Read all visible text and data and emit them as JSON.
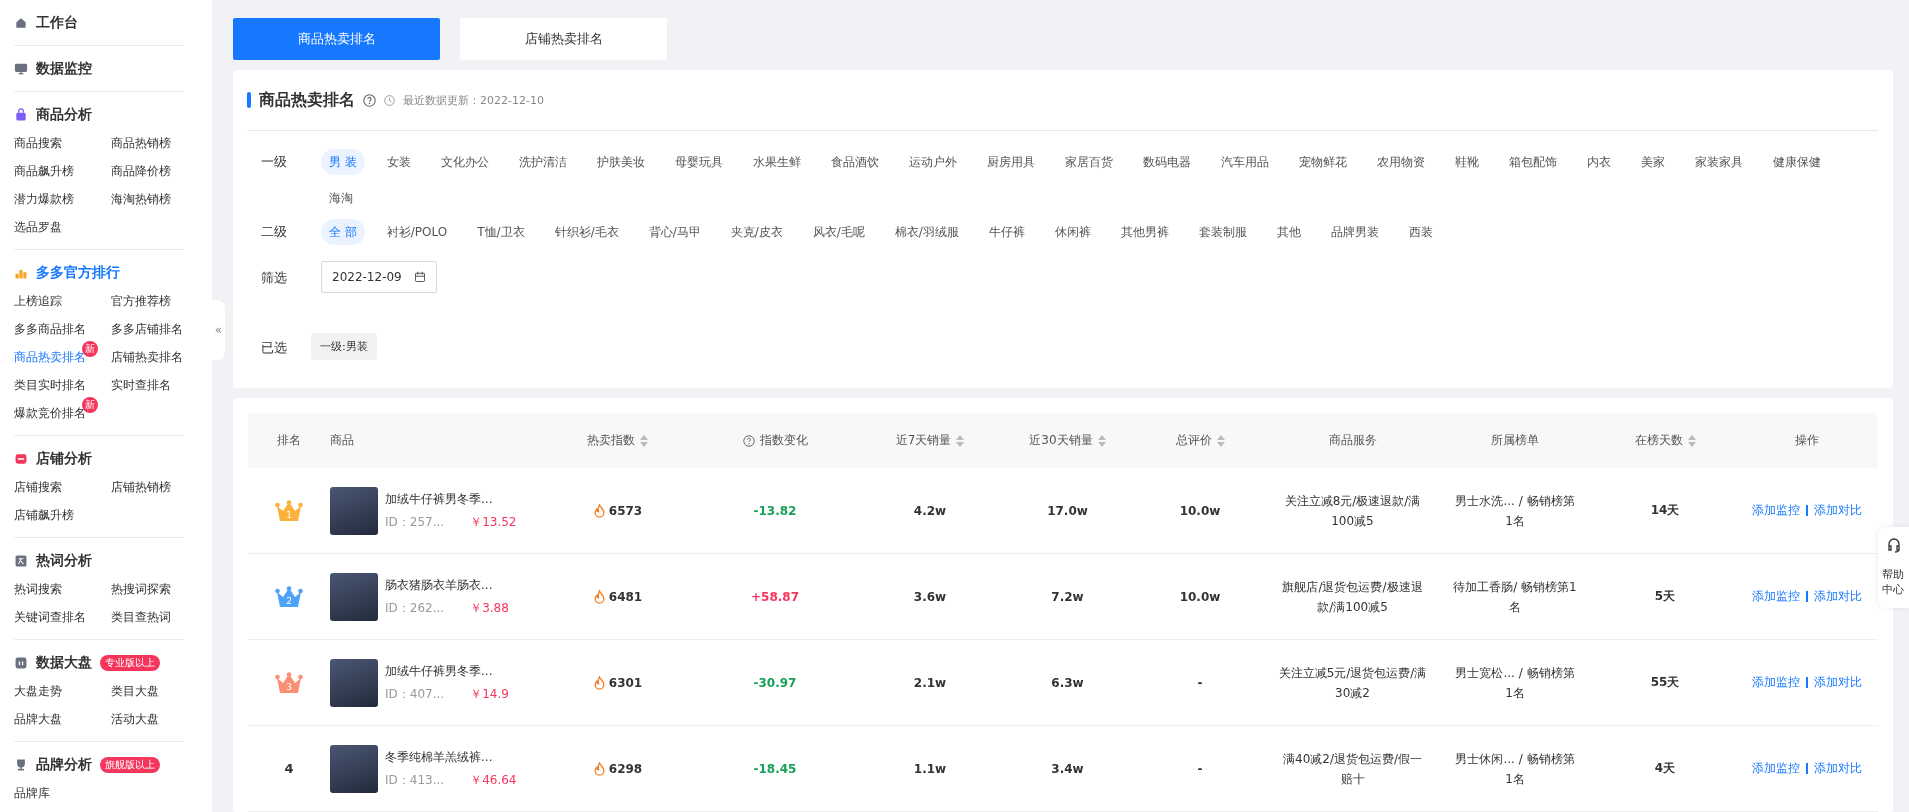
{
  "sidebar": {
    "sections": [
      {
        "title": "工作台",
        "active": false
      },
      {
        "title": "数据监控",
        "active": false
      },
      {
        "title": "商品分析",
        "active": false,
        "items": [
          {
            "label": "商品搜索",
            "selected": false
          },
          {
            "label": "商品热销榜",
            "selected": false
          },
          {
            "label": "商品飙升榜",
            "selected": false
          },
          {
            "label": "商品降价榜",
            "selected": false
          },
          {
            "label": "潜力爆款榜",
            "selected": false
          },
          {
            "label": "海淘热销榜",
            "selected": false
          },
          {
            "label": "选品罗盘",
            "selected": false
          }
        ]
      },
      {
        "title": "多多官方排行",
        "active": true,
        "items": [
          {
            "label": "上榜追踪",
            "selected": false
          },
          {
            "label": "官方推荐榜",
            "selected": false
          },
          {
            "label": "多多商品排名",
            "selected": false
          },
          {
            "label": "多多店铺排名",
            "selected": false
          },
          {
            "label": "商品热卖排名",
            "selected": true,
            "badge": "新"
          },
          {
            "label": "店铺热卖排名",
            "selected": false
          },
          {
            "label": "类目实时排名",
            "selected": false
          },
          {
            "label": "实时查排名",
            "selected": false
          },
          {
            "label": "爆款竞价排名",
            "selected": false,
            "badge": "新"
          }
        ]
      },
      {
        "title": "店铺分析",
        "active": false,
        "items": [
          {
            "label": "店铺搜索",
            "selected": false
          },
          {
            "label": "店铺热销榜",
            "selected": false
          },
          {
            "label": "店铺飙升榜",
            "selected": false
          }
        ]
      },
      {
        "title": "热词分析",
        "active": false,
        "items": [
          {
            "label": "热词搜索",
            "selected": false
          },
          {
            "label": "热搜词探索",
            "selected": false
          },
          {
            "label": "关键词查排名",
            "selected": false
          },
          {
            "label": "类目查热词",
            "selected": false
          }
        ]
      },
      {
        "title": "数据大盘",
        "active": false,
        "tag": "专业版以上",
        "items": [
          {
            "label": "大盘走势",
            "selected": false
          },
          {
            "label": "类目大盘",
            "selected": false
          },
          {
            "label": "品牌大盘",
            "selected": false
          },
          {
            "label": "活动大盘",
            "selected": false
          }
        ]
      },
      {
        "title": "品牌分析",
        "active": false,
        "tag": "旗舰版以上",
        "items": [
          {
            "label": "品牌库",
            "selected": false
          }
        ]
      }
    ]
  },
  "collapse": {
    "label": "«"
  },
  "tabs": [
    {
      "label": "商品热卖排名",
      "selected": true
    },
    {
      "label": "店铺热卖排名",
      "selected": false
    }
  ],
  "filter": {
    "title": "商品热卖排名",
    "updated": "最近数据更新：2022-12-10",
    "level1": {
      "label": "一级",
      "options": [
        {
          "label": "男 装",
          "selected": true
        },
        {
          "label": "女装",
          "selected": false
        },
        {
          "label": "文化办公",
          "selected": false
        },
        {
          "label": "洗护清洁",
          "selected": false
        },
        {
          "label": "护肤美妆",
          "selected": false
        },
        {
          "label": "母婴玩具",
          "selected": false
        },
        {
          "label": "水果生鲜",
          "selected": false
        },
        {
          "label": "食品酒饮",
          "selected": false
        },
        {
          "label": "运动户外",
          "selected": false
        },
        {
          "label": "厨房用具",
          "selected": false
        },
        {
          "label": "家居百货",
          "selected": false
        },
        {
          "label": "数码电器",
          "selected": false
        },
        {
          "label": "汽车用品",
          "selected": false
        },
        {
          "label": "宠物鲜花",
          "selected": false
        },
        {
          "label": "农用物资",
          "selected": false
        },
        {
          "label": "鞋靴",
          "selected": false
        },
        {
          "label": "箱包配饰",
          "selected": false
        },
        {
          "label": "内衣",
          "selected": false
        },
        {
          "label": "美家",
          "selected": false
        },
        {
          "label": "家装家具",
          "selected": false
        },
        {
          "label": "健康保健",
          "selected": false
        },
        {
          "label": "海淘",
          "selected": false
        }
      ]
    },
    "level2": {
      "label": "二级",
      "options": [
        {
          "label": "全 部",
          "selected": true
        },
        {
          "label": "衬衫/POLO",
          "selected": false
        },
        {
          "label": "T恤/卫衣",
          "selected": false
        },
        {
          "label": "针织衫/毛衣",
          "selected": false
        },
        {
          "label": "背心/马甲",
          "selected": false
        },
        {
          "label": "夹克/皮衣",
          "selected": false
        },
        {
          "label": "风衣/毛呢",
          "selected": false
        },
        {
          "label": "棉衣/羽绒服",
          "selected": false
        },
        {
          "label": "牛仔裤",
          "selected": false
        },
        {
          "label": "休闲裤",
          "selected": false
        },
        {
          "label": "其他男裤",
          "selected": false
        },
        {
          "label": "套装制服",
          "selected": false
        },
        {
          "label": "其他",
          "selected": false
        },
        {
          "label": "品牌男装",
          "selected": false
        },
        {
          "label": "西装",
          "selected": false
        }
      ]
    },
    "date": {
      "label": "筛选",
      "value": "2022-12-09"
    },
    "chosen": {
      "label": "已选",
      "tags": [
        "一级:男装"
      ]
    }
  },
  "table": {
    "columns": [
      {
        "label": "排名",
        "sortable": false,
        "help": false
      },
      {
        "label": "商品",
        "sortable": false,
        "help": false
      },
      {
        "label": "热卖指数",
        "sortable": true,
        "help": false
      },
      {
        "label": "指数变化",
        "sortable": false,
        "help": true
      },
      {
        "label": "近7天销量",
        "sortable": true,
        "help": false
      },
      {
        "label": "近30天销量",
        "sortable": true,
        "help": false
      },
      {
        "label": "总评价",
        "sortable": true,
        "help": false
      },
      {
        "label": "商品服务",
        "sortable": false,
        "help": false
      },
      {
        "label": "所属榜单",
        "sortable": false,
        "help": false
      },
      {
        "label": "在榜天数",
        "sortable": true,
        "help": false
      },
      {
        "label": "操作",
        "sortable": false,
        "help": false
      }
    ],
    "rows": [
      {
        "rank": {
          "kind": "crown",
          "text": "1",
          "color": "#fbb13c"
        },
        "title": "加绒牛仔裤男冬季...",
        "id": "ID：257...",
        "price": "￥13.52",
        "hot": "6573",
        "change": "-13.82",
        "color": "#18a058",
        "sales7": "4.2w",
        "sales30": "17.0w",
        "reviews": "10.0w",
        "service": "关注立减8元/极速退款/满100减5",
        "list": "男士水洗...  / 畅销榜第1名",
        "days": "14天",
        "actions": [
          "添加监控",
          "添加对比"
        ]
      },
      {
        "rank": {
          "kind": "crown",
          "text": "2",
          "color": "#4da3f7"
        },
        "title": "肠衣猪肠衣羊肠衣...",
        "id": "ID：262...",
        "price": "￥3.88",
        "hot": "6481",
        "change": "+58.87",
        "color": "#f5365c",
        "sales7": "3.6w",
        "sales30": "7.2w",
        "reviews": "10.0w",
        "service": "旗舰店/退货包运费/极速退款/满100减5",
        "list": "待加工香肠/ 畅销榜第1名",
        "days": "5天",
        "actions": [
          "添加监控",
          "添加对比"
        ]
      },
      {
        "rank": {
          "kind": "crown",
          "text": "3",
          "color": "#fb8f74"
        },
        "title": "加绒牛仔裤男冬季...",
        "id": "ID：407...",
        "price": "￥14.9",
        "hot": "6301",
        "change": "-30.97",
        "color": "#18a058",
        "sales7": "2.1w",
        "sales30": "6.3w",
        "reviews": "-",
        "service": "关注立减5元/退货包运费/满30减2",
        "list": "男士宽松...  / 畅销榜第1名",
        "days": "55天",
        "actions": [
          "添加监控",
          "添加对比"
        ]
      },
      {
        "rank": {
          "kind": "plain",
          "text": "4"
        },
        "title": "冬季纯棉羊羔绒裤...",
        "id": "ID：413...",
        "price": "￥46.64",
        "hot": "6298",
        "change": "-18.45",
        "color": "#18a058",
        "sales7": "1.1w",
        "sales30": "3.4w",
        "reviews": "-",
        "service": "满40减2/退货包运费/假一赔十",
        "list": "男士休闲...  / 畅销榜第1名",
        "days": "4天",
        "actions": [
          "添加监控",
          "添加对比"
        ]
      }
    ]
  },
  "help": {
    "label": "帮助中心"
  }
}
